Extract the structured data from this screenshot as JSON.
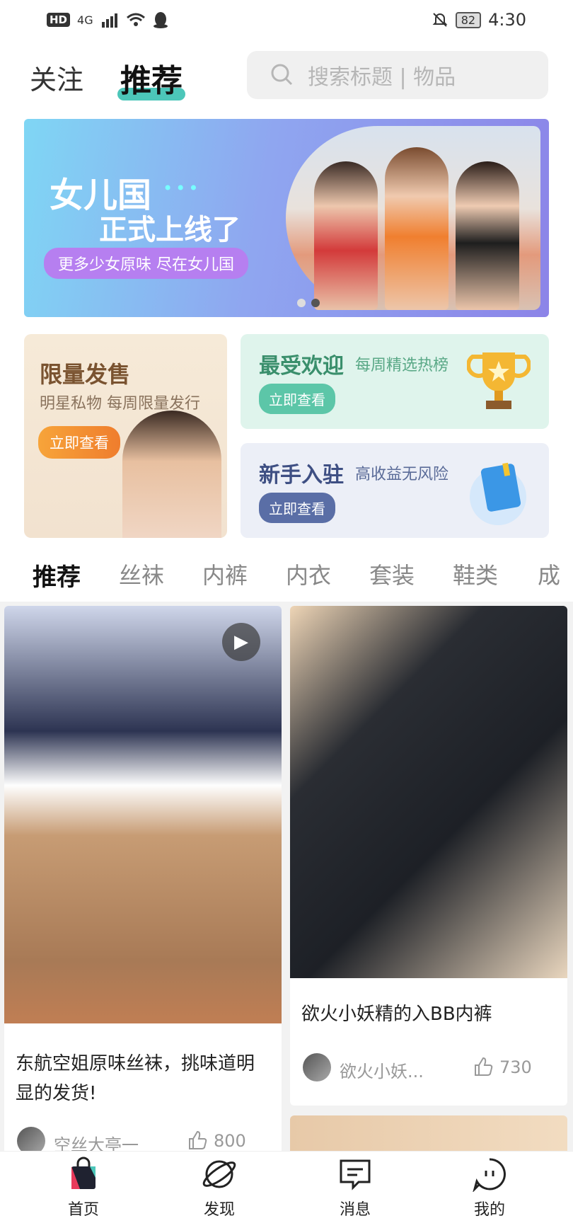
{
  "status_bar": {
    "hd": "HD",
    "network": "4G",
    "battery": "82",
    "time": "4:30"
  },
  "header": {
    "tab_follow": "关注",
    "tab_recommend": "推荐",
    "search_placeholder": "搜索标题 | 物品"
  },
  "banner": {
    "title_line1": "女儿国",
    "title_line2": "正式上线了",
    "subtitle": "更多少女原味 尽在女儿国"
  },
  "cards": {
    "limited": {
      "title": "限量发售",
      "subtitle": "明星私物 每周限量发行",
      "button": "立即查看"
    },
    "popular": {
      "title": "最受欢迎",
      "subtitle": "每周精选热榜",
      "button": "立即查看"
    },
    "newcomer": {
      "title": "新手入驻",
      "subtitle": "高收益无风险",
      "button": "立即查看"
    }
  },
  "categories": [
    "推荐",
    "丝袜",
    "内裤",
    "内衣",
    "套装",
    "鞋类",
    "成"
  ],
  "feed": [
    {
      "title": "东航空姐原味丝袜，挑味道明显的发货!",
      "author": "空丝大亭一",
      "likes": "800"
    },
    {
      "title": "欲火小妖精的入BB内裤",
      "author": "欲火小妖...",
      "likes": "730"
    }
  ],
  "bottom_nav": [
    "首页",
    "发现",
    "消息",
    "我的"
  ],
  "colors": {
    "accent": "#4cc6b9",
    "orange": "#ef7d2d",
    "teal_button": "#5cc6a8",
    "navy_button": "#5a6ea6"
  }
}
